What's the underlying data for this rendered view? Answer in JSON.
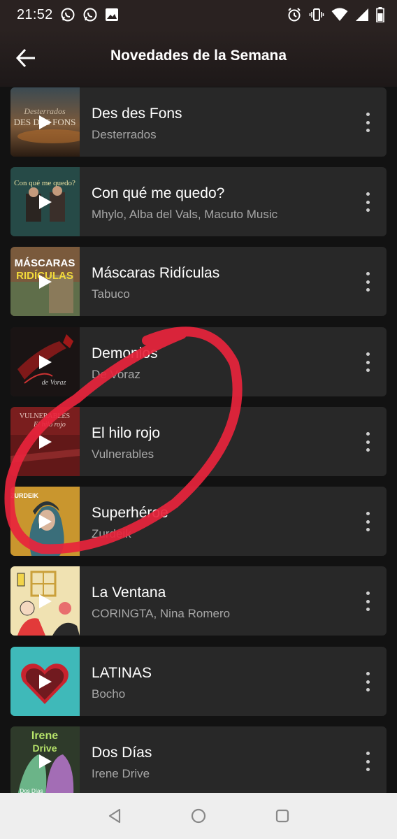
{
  "status": {
    "time": "21:52"
  },
  "header": {
    "title": "Novedades de la Semana"
  },
  "releases": [
    {
      "title": "Des des Fons",
      "artist": "Desterrados",
      "cover_text": "Desterrados DES DES FONS"
    },
    {
      "title": "Con qué me quedo?",
      "artist": "Mhylo, Alba del Vals, Macuto Music",
      "cover_text": "Con qué me quedo?"
    },
    {
      "title": "Máscaras Ridículas",
      "artist": "Tabuco",
      "cover_text": "MÁSCARAS RIDÍCULAS"
    },
    {
      "title": "Demonios",
      "artist": "De Voraz",
      "cover_text": "de Voraz"
    },
    {
      "title": "El hilo rojo",
      "artist": "Vulnerables",
      "cover_text": "VULNERABLES El hilo rojo"
    },
    {
      "title": "Superhéroe",
      "artist": "Zurdeik",
      "cover_text": "ZURDEIK"
    },
    {
      "title": "La Ventana",
      "artist": "CORINGTA, Nina Romero",
      "cover_text": ""
    },
    {
      "title": "LATINAS",
      "artist": "Bocho",
      "cover_text": ""
    },
    {
      "title": "Dos Días",
      "artist": "Irene Drive",
      "cover_text": "Irene Drive Dos Días"
    }
  ],
  "icons": {
    "back": "arrow-left-icon",
    "more": "more-vertical-icon",
    "play": "play-icon",
    "nav_back": "triangle-back-icon",
    "nav_home": "circle-home-icon",
    "nav_recents": "square-recents-icon"
  },
  "colors": {
    "background": "#121212",
    "card": "#282828",
    "annotation_circle": "#e8243c",
    "subtitle": "#a7a7a7"
  }
}
